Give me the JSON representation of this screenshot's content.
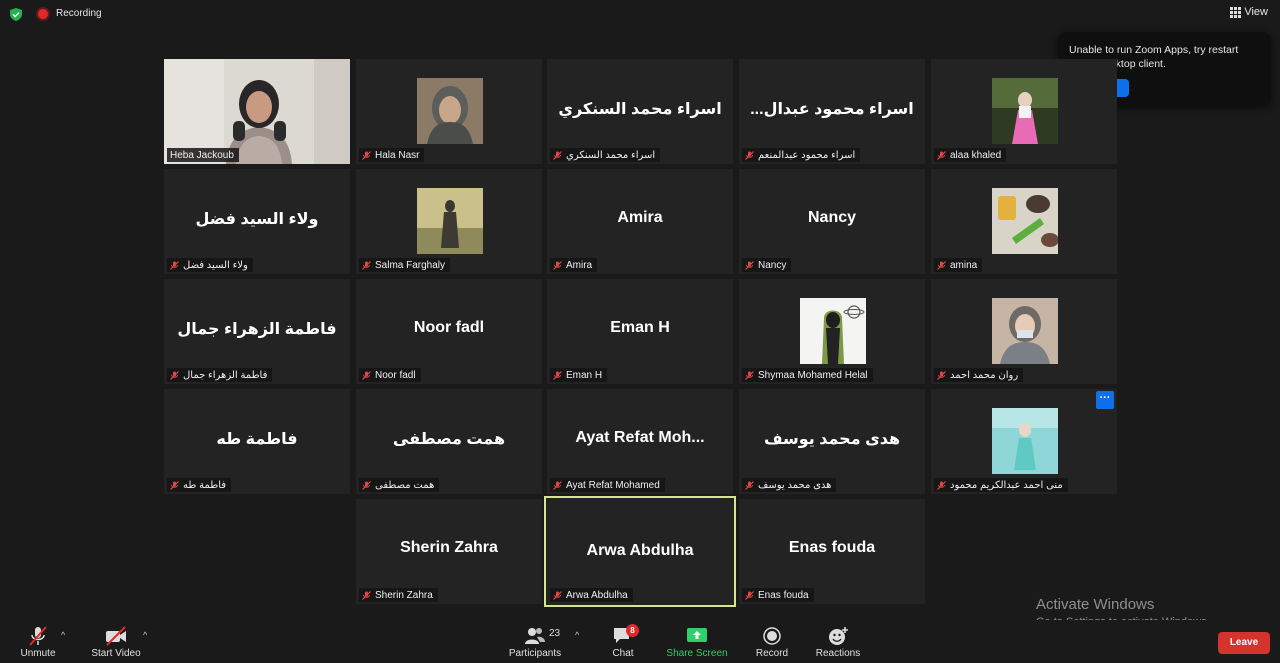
{
  "topbar": {
    "recording_label": "Recording",
    "view_label": "View"
  },
  "popup": {
    "message": "Unable to run Zoom Apps, try restart Zoom desktop client.",
    "ok_label": "Ok"
  },
  "tiles": {
    "heba": {
      "name": "Heba Jackoub"
    },
    "hala": {
      "name": "Hala Nasr"
    },
    "esraa_s": {
      "display": "اسراء محمد السنكري",
      "name": "اسراء محمد السنكري"
    },
    "esraa_a": {
      "display": "...اسراء محمود عبدال",
      "name": "اسراء محمود عبدالمنعم"
    },
    "alaa": {
      "name": "alaa khaled"
    },
    "walaa": {
      "display": "ولاء السيد فضل",
      "name": "ولاء السيد فضل"
    },
    "salma": {
      "name": "Salma Farghaly"
    },
    "amira": {
      "display": "Amira",
      "name": "Amira"
    },
    "nancy": {
      "display": "Nancy",
      "name": "Nancy"
    },
    "amina": {
      "name": "amina"
    },
    "fatma_z": {
      "display": "فاطمة الزهراء جمال",
      "name": "فاطمة الزهراء جمال"
    },
    "noor": {
      "display": "Noor fadl",
      "name": "Noor fadl"
    },
    "eman": {
      "display": "Eman H",
      "name": "Eman H"
    },
    "shymaa": {
      "name": "Shymaa Mohamed Helal"
    },
    "rawan": {
      "name": "روان محمد احمد"
    },
    "fatma_t": {
      "display": "فاطمة طه",
      "name": "فاطمة طه"
    },
    "hemmat": {
      "display": "همت مصطفى",
      "name": "همت مصطفى"
    },
    "ayat": {
      "display": "Ayat Refat Moh...",
      "name": "Ayat Refat Mohamed"
    },
    "hoda": {
      "display": "هدى محمد يوسف",
      "name": "هدى محمد يوسف"
    },
    "mona": {
      "name": "منى احمد عبدالكريم محمود"
    },
    "sherin": {
      "display": "Sherin Zahra",
      "name": "Sherin Zahra"
    },
    "arwa": {
      "display": "Arwa Abdulha",
      "name": "Arwa Abdulha"
    },
    "enas": {
      "display": "Enas fouda",
      "name": "Enas fouda"
    }
  },
  "more_button": "···",
  "watermark": {
    "line1": "Activate Windows",
    "line2": "Go to Settings to activate Windows."
  },
  "toolbar": {
    "unmute": "Unmute",
    "start_video": "Start Video",
    "participants": "Participants",
    "participants_count": "23",
    "chat": "Chat",
    "chat_badge": "8",
    "share_screen": "Share Screen",
    "record": "Record",
    "reactions": "Reactions",
    "leave": "Leave"
  },
  "colors": {
    "accent_blue": "#0e71eb",
    "leave_red": "#d5332e",
    "share_green": "#2fcf6a",
    "active_speaker": "#d4e58c"
  }
}
